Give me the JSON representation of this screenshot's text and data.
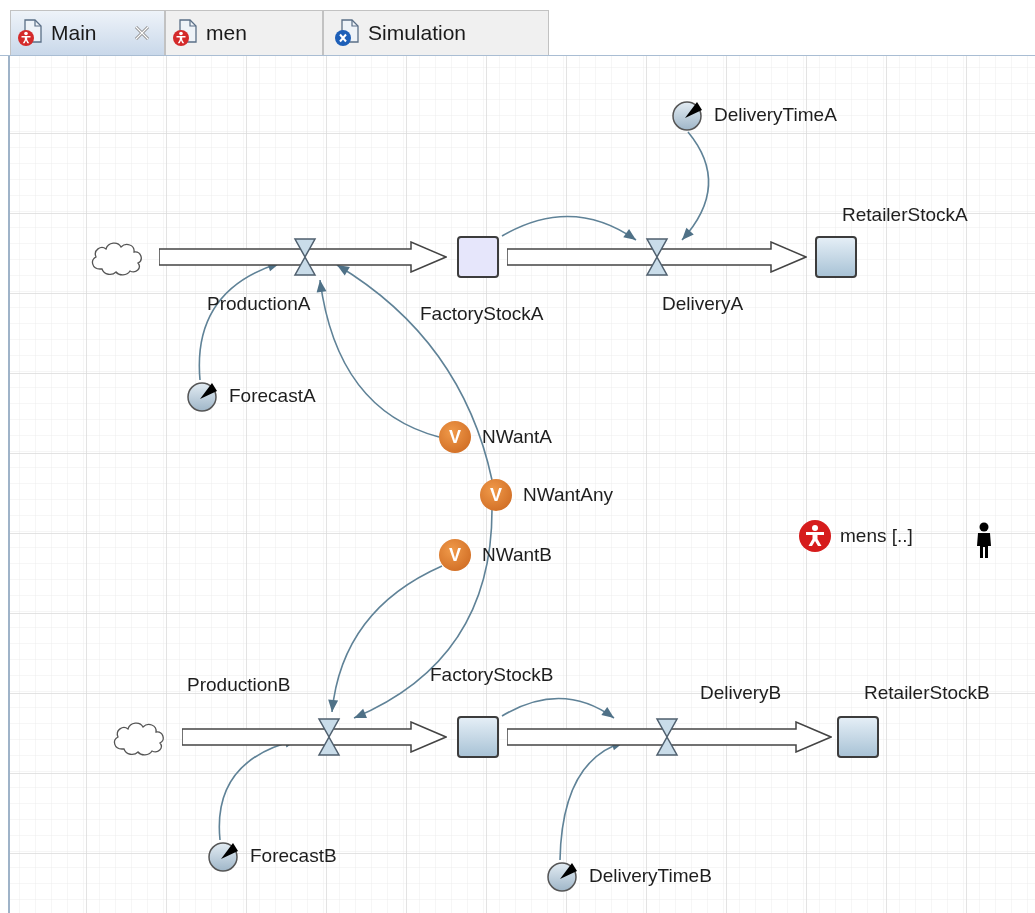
{
  "tabs": [
    {
      "label": "Main",
      "kind": "agent",
      "selected": true,
      "closable": true
    },
    {
      "label": "men",
      "kind": "agent",
      "selected": false,
      "closable": false
    },
    {
      "label": "Simulation",
      "kind": "experiment",
      "selected": false,
      "closable": false
    }
  ],
  "diagram": {
    "flows": [
      {
        "name": "ProductionA"
      },
      {
        "name": "DeliveryA"
      },
      {
        "name": "ProductionB"
      },
      {
        "name": "DeliveryB"
      }
    ],
    "stocks": [
      {
        "name": "FactoryStockA",
        "selected": true
      },
      {
        "name": "RetailerStockA",
        "selected": false
      },
      {
        "name": "FactoryStockB",
        "selected": false
      },
      {
        "name": "RetailerStockB",
        "selected": false
      }
    ],
    "parameters": [
      {
        "name": "DeliveryTimeA"
      },
      {
        "name": "ForecastA"
      },
      {
        "name": "ForecastB"
      },
      {
        "name": "DeliveryTimeB"
      }
    ],
    "variables": [
      {
        "name": "NWantA",
        "badge": "V"
      },
      {
        "name": "NWantAny",
        "badge": "V"
      },
      {
        "name": "NWantB",
        "badge": "V"
      }
    ],
    "population": {
      "name": "mens [..]"
    }
  }
}
